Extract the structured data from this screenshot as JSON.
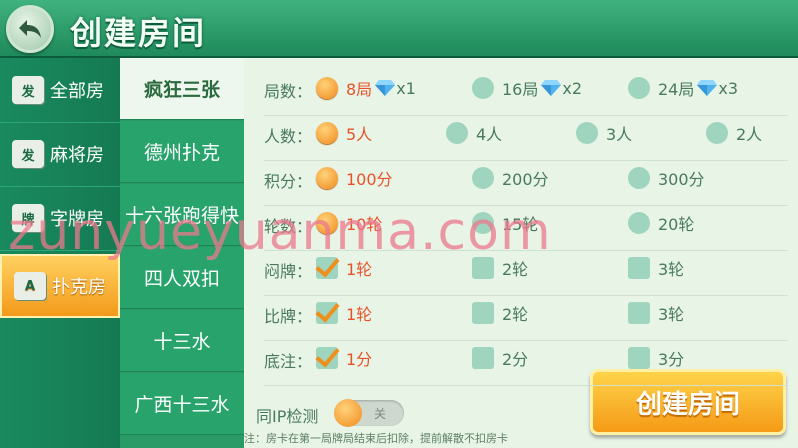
{
  "header": {
    "title": "创建房间"
  },
  "nav": {
    "items": [
      {
        "label": "全部房",
        "icon": "发"
      },
      {
        "label": "麻将房",
        "icon": "发"
      },
      {
        "label": "字牌房",
        "icon": "牌"
      },
      {
        "label": "扑克房",
        "icon": "A"
      }
    ],
    "active_index": 3
  },
  "games": [
    "疯狂三张",
    "德州扑克",
    "十六张跑得快",
    "四人双扣",
    "十三水",
    "广西十三水"
  ],
  "rows": [
    {
      "label": "局数：",
      "type": "radio",
      "options": [
        {
          "text": "8局",
          "gem": "x1",
          "selected": true
        },
        {
          "text": "16局",
          "gem": "x2",
          "selected": false
        },
        {
          "text": "24局",
          "gem": "x3",
          "selected": false
        }
      ]
    },
    {
      "label": "人数：",
      "type": "radio",
      "options": [
        {
          "text": "5人",
          "selected": true
        },
        {
          "text": "4人",
          "selected": false
        },
        {
          "text": "3人",
          "selected": false
        },
        {
          "text": "2人",
          "selected": false
        }
      ]
    },
    {
      "label": "积分：",
      "type": "radio",
      "options": [
        {
          "text": "100分",
          "selected": true
        },
        {
          "text": "200分",
          "selected": false
        },
        {
          "text": "300分",
          "selected": false
        }
      ]
    },
    {
      "label": "轮数：",
      "type": "radio",
      "options": [
        {
          "text": "10轮",
          "selected": true
        },
        {
          "text": "15轮",
          "selected": false
        },
        {
          "text": "20轮",
          "selected": false
        }
      ]
    },
    {
      "label": "闷牌：",
      "type": "check",
      "options": [
        {
          "text": "1轮",
          "selected": true
        },
        {
          "text": "2轮",
          "selected": false
        },
        {
          "text": "3轮",
          "selected": false
        }
      ]
    },
    {
      "label": "比牌：",
      "type": "check",
      "options": [
        {
          "text": "1轮",
          "selected": true
        },
        {
          "text": "2轮",
          "selected": false
        },
        {
          "text": "3轮",
          "selected": false
        }
      ]
    },
    {
      "label": "底注：",
      "type": "check",
      "options": [
        {
          "text": "1分",
          "selected": true
        },
        {
          "text": "2分",
          "selected": false
        },
        {
          "text": "3分",
          "selected": false
        }
      ]
    }
  ],
  "ip_check": {
    "label": "同IP检测",
    "state": "关"
  },
  "note": "注：房卡在第一局牌局结束后扣除，提前解散不扣房卡",
  "create_button": "创建房间",
  "watermark": "zunyueyuanma.com",
  "colors": {
    "accent_orange": "#f59a16",
    "header_green": "#2c9c6b",
    "panel_bg": "#e7f4e6",
    "selected_text": "#e8522a"
  }
}
